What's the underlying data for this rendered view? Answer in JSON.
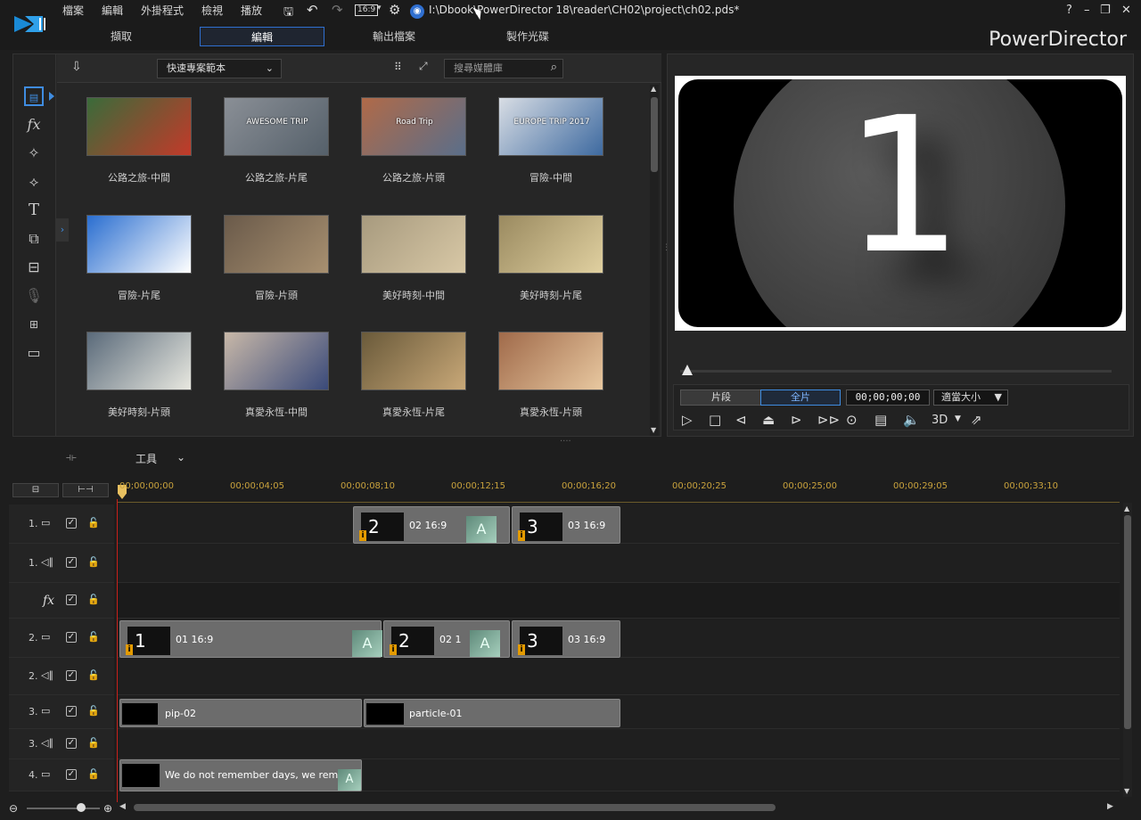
{
  "menu": [
    "檔案",
    "編輯",
    "外掛程式",
    "檢視",
    "播放"
  ],
  "aspect": "16:9",
  "filepath": "I:\\Dbook\\PowerDirector 18\\reader\\CH02\\project\\ch02.pds*",
  "window_buttons": [
    "?",
    "–",
    "❐",
    "✕"
  ],
  "tabs": [
    "擷取",
    "編輯",
    "輸出檔案",
    "製作光碟"
  ],
  "active_tab": "編輯",
  "brand": "PowerDirector",
  "library": {
    "template_dropdown": "快速專案範本",
    "search_placeholder": "搜尋媒體庫",
    "items": [
      {
        "label": "公路之旅-中間",
        "colors": [
          "#3a6b3a",
          "#c23a2a"
        ]
      },
      {
        "label": "公路之旅-片尾",
        "colors": [
          "#8a8f96",
          "#55606a"
        ],
        "text": "AWESOME TRIP"
      },
      {
        "label": "公路之旅-片頭",
        "colors": [
          "#b06a48",
          "#5a6e8a"
        ],
        "text": "Road Trip"
      },
      {
        "label": "冒險-中間",
        "colors": [
          "#d8dde4",
          "#3e6aa0"
        ],
        "text": "EUROPE TRIP 2017"
      },
      {
        "label": "冒險-片尾",
        "colors": [
          "#2a6ed0",
          "#ffffff"
        ]
      },
      {
        "label": "冒險-片頭",
        "colors": [
          "#6a5a4a",
          "#a89070"
        ]
      },
      {
        "label": "美好時刻-中間",
        "colors": [
          "#a79a7e",
          "#d8c8a6"
        ]
      },
      {
        "label": "美好時刻-片尾",
        "colors": [
          "#9a8a60",
          "#e0d0a0"
        ]
      },
      {
        "label": "美好時刻-片頭",
        "colors": [
          "#5a6a7a",
          "#e8e8e0"
        ]
      },
      {
        "label": "真愛永恆-中間",
        "colors": [
          "#c8b8a8",
          "#3a4a7a"
        ]
      },
      {
        "label": "真愛永恆-片尾",
        "colors": [
          "#6a5a3a",
          "#c8a878"
        ]
      },
      {
        "label": "真愛永恆-片頭",
        "colors": [
          "#a06a4a",
          "#e8c8a0"
        ]
      }
    ]
  },
  "preview": {
    "number": "1",
    "mode_clip": "片段",
    "mode_movie": "全片",
    "timecode": "00;00;00;00",
    "zoom": "適當大小",
    "threeD": "3D"
  },
  "timeline": {
    "tools_label": "工具",
    "ruler": [
      "00;00;00;00",
      "00;00;04;05",
      "00;00;08;10",
      "00;00;12;15",
      "00;00;16;20",
      "00;00;20;25",
      "00;00;25;00",
      "00;00;29;05",
      "00;00;33;10"
    ],
    "tracks": [
      {
        "num": "1.",
        "kind": "video"
      },
      {
        "num": "1.",
        "kind": "audio"
      },
      {
        "num": "",
        "kind": "fx"
      },
      {
        "num": "2.",
        "kind": "video"
      },
      {
        "num": "2.",
        "kind": "audio"
      },
      {
        "num": "3.",
        "kind": "video"
      },
      {
        "num": "3.",
        "kind": "audio"
      },
      {
        "num": "4.",
        "kind": "video"
      }
    ],
    "clips": {
      "t1_a": {
        "num": "2",
        "label": "02 16:9"
      },
      "t1_b": {
        "num": "3",
        "label": "03 16:9"
      },
      "t2_a": {
        "num": "1",
        "label": "01 16:9"
      },
      "t2_b": {
        "num": "2",
        "label": "02 1"
      },
      "t2_c": {
        "num": "3",
        "label": "03 16:9"
      },
      "pip": "pip-02",
      "particle": "particle-01",
      "title": "We do not remember days, we rem"
    },
    "badge_a": "A",
    "badge_i": "i"
  }
}
